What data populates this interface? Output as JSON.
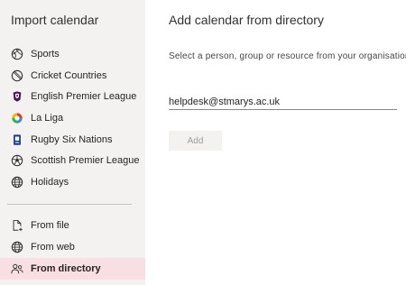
{
  "sidebar": {
    "title": "Import calendar",
    "items": [
      {
        "label": "Sports",
        "icon": "sports-ball-icon"
      },
      {
        "label": "Cricket Countries",
        "icon": "cricket-ball-icon"
      },
      {
        "label": "English Premier League",
        "icon": "premier-league-logo-icon"
      },
      {
        "label": "La Liga",
        "icon": "la-liga-logo-icon"
      },
      {
        "label": "Rugby Six Nations",
        "icon": "six-nations-logo-icon"
      },
      {
        "label": "Scottish Premier League",
        "icon": "soccer-ball-icon"
      },
      {
        "label": "Holidays",
        "icon": "globe-icon"
      }
    ],
    "sources": [
      {
        "label": "From file",
        "icon": "file-add-icon"
      },
      {
        "label": "From web",
        "icon": "globe-icon"
      },
      {
        "label": "From directory",
        "icon": "people-icon",
        "selected": true
      }
    ]
  },
  "main": {
    "title": "Add calendar from directory",
    "instruction": "Select a person, group or resource from your organisation's d",
    "input_value": "helpdesk@stmarys.ac.uk",
    "add_label": "Add"
  },
  "colors": {
    "sidebar_bg": "#f3f2f1",
    "selected_bg": "#f7dfe3",
    "disabled_button_bg": "#f3f2f1",
    "disabled_button_text": "#a19f9d"
  }
}
